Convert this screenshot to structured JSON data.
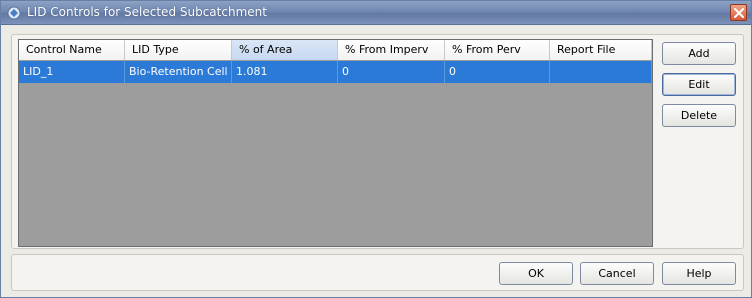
{
  "window": {
    "title": "LID Controls for Selected Subcatchment",
    "icon": "swmm-app-icon",
    "close_icon": "close-icon"
  },
  "grid": {
    "columns": [
      "Control Name",
      "LID Type",
      "% of Area",
      "% From Imperv",
      "% From Perv",
      "Report File"
    ],
    "sorted_column": "% of Area",
    "rows": [
      [
        "LID_1",
        "Bio-Retention Cell",
        "1.081",
        "0",
        "0",
        ""
      ]
    ],
    "selected_row_color": "#2b7ad7"
  },
  "side_buttons": {
    "add": "Add",
    "edit": "Edit",
    "delete": "Delete"
  },
  "bottom_buttons": {
    "ok": "OK",
    "cancel": "Cancel",
    "help": "Help"
  }
}
